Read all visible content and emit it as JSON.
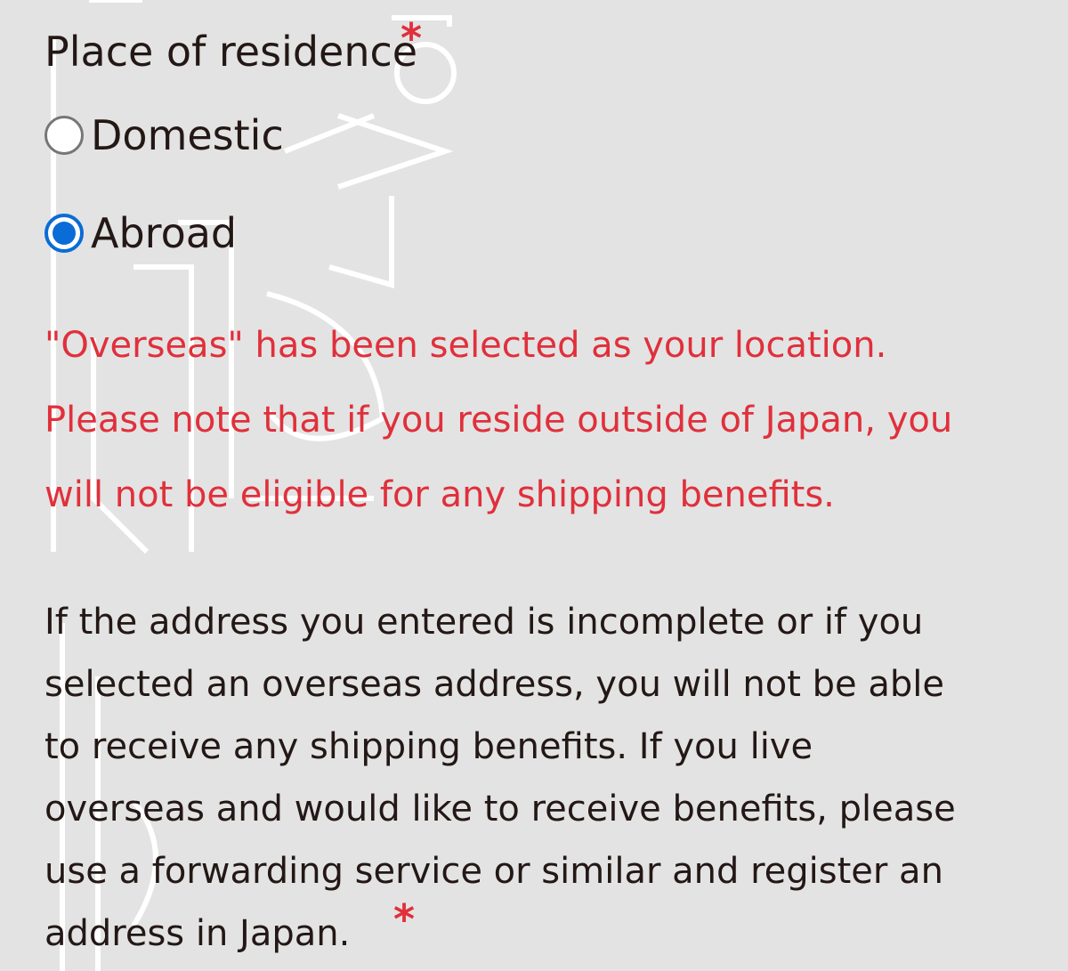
{
  "field": {
    "label": "Place of residence",
    "required_mark": "*"
  },
  "options": [
    {
      "label": "Domestic",
      "selected": false
    },
    {
      "label": "Abroad",
      "selected": true
    }
  ],
  "notice": {
    "lines": [
      "\"Overseas\" has been selected as your location.",
      "Please note that if you reside outside of Japan, you",
      "will not be eligible for any shipping benefits."
    ]
  },
  "info": {
    "lines": [
      "If the address you entered is incomplete or if you",
      "selected an overseas address, you will not be able",
      "to receive any shipping benefits. If you live",
      "overseas and would like to receive benefits, please",
      "use a forwarding service or similar and register an",
      "address in Japan."
    ],
    "required_mark": "*"
  },
  "colors": {
    "background": "#e3e3e3",
    "text": "#231815",
    "alert": "#e0303b",
    "radio_selected": "#0a6cd6"
  }
}
